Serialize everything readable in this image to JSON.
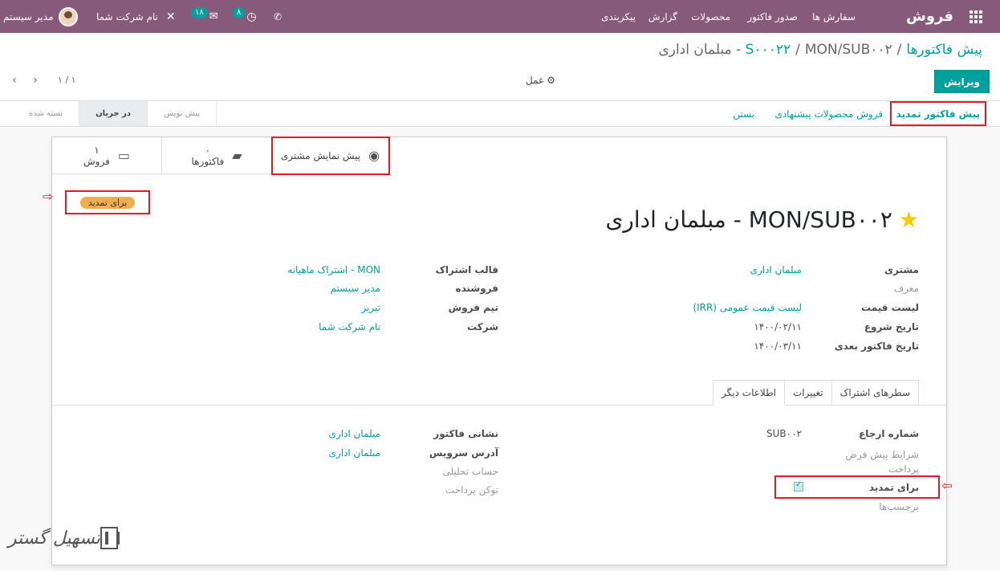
{
  "navbar": {
    "brand": "فروش",
    "menu": [
      "سفارش ها",
      "صدور فاکتور",
      "محصولات",
      "گزارش",
      "پیکربندی"
    ],
    "activities_count": "۸",
    "messages_count": "۱۸",
    "company": "نام شرکت شما",
    "user": "مدیر سیستم"
  },
  "breadcrumb": {
    "root": "پیش فاکتورها",
    "parent": "S۰۰۰۲۲",
    "current": "MON/SUB۰۰۲ - مبلمان اداری"
  },
  "control": {
    "edit_label": "ویرایش",
    "action_label": "عمل",
    "pager": "۱ / ۱"
  },
  "statusbar": {
    "buttons": [
      "پیش فاکتور تمدید",
      "فروش محصولات پیشنهادی",
      "بستن"
    ],
    "stages": [
      "بسته شده",
      "در جریان",
      "پیش نویس"
    ],
    "current_stage": "در جریان"
  },
  "smart_buttons": [
    {
      "label": "پیش نمایش مشتری",
      "icon": "globe-icon"
    },
    {
      "count": "۰",
      "label": "فاکتورها",
      "icon": "book-icon"
    },
    {
      "count": "۱",
      "label": "فروش",
      "icon": "credit-card-icon"
    }
  ],
  "ribbon": "برای تمدید",
  "record_title": "MON/SUB۰۰۲ - مبلمان اداری",
  "fields_right": {
    "customer_label": "مشتری",
    "customer": "مبلمان اداری",
    "referrer_label": "معرف",
    "pricelist_label": "لیست قیمت",
    "pricelist": "لیست قیمت عمومی (IRR)",
    "start_label": "تاریخ شروع",
    "start": "۱۴۰۰/۰۲/۱۱",
    "next_invoice_label": "تاریخ فاکتور بعدی",
    "next_invoice": "۱۴۰۰/۰۳/۱۱"
  },
  "fields_left": {
    "template_label": "قالب اشتراک",
    "template": "MON - اشتراک ماهیانه",
    "salesperson_label": "فروشنده",
    "salesperson": "مدیر سیستم",
    "team_label": "تیم فروش",
    "team": "تبریز",
    "company_label": "شرکت",
    "company": "نام شرکت شما"
  },
  "tabs": [
    "سطرهای اشتراک",
    "تغییرات",
    "اطلاعات دیگر"
  ],
  "active_tab": "اطلاعات دیگر",
  "other_info": {
    "ref_label": "شماره ارجاع",
    "ref": "SUB۰۰۲",
    "payment_terms_label": "شرایط پیش فرض پرداخت",
    "renew_label": "برای تمدید",
    "renew_checked": true,
    "tags_label": "برچسب‌ها",
    "invoice_addr_label": "نشانی فاکتور",
    "invoice_addr": "مبلمان اداری",
    "service_addr_label": "آدرس سرویس",
    "service_addr": "مبلمان اداری",
    "analytic_label": "حساب تحلیلی",
    "payment_token_label": "توکن پرداخت"
  },
  "watermark": "تسهیل گستر",
  "colors": {
    "navbar": "#875a7b",
    "accent": "#00a09d",
    "highlight": "#e01b24",
    "ribbon": "#f0ad4e"
  }
}
